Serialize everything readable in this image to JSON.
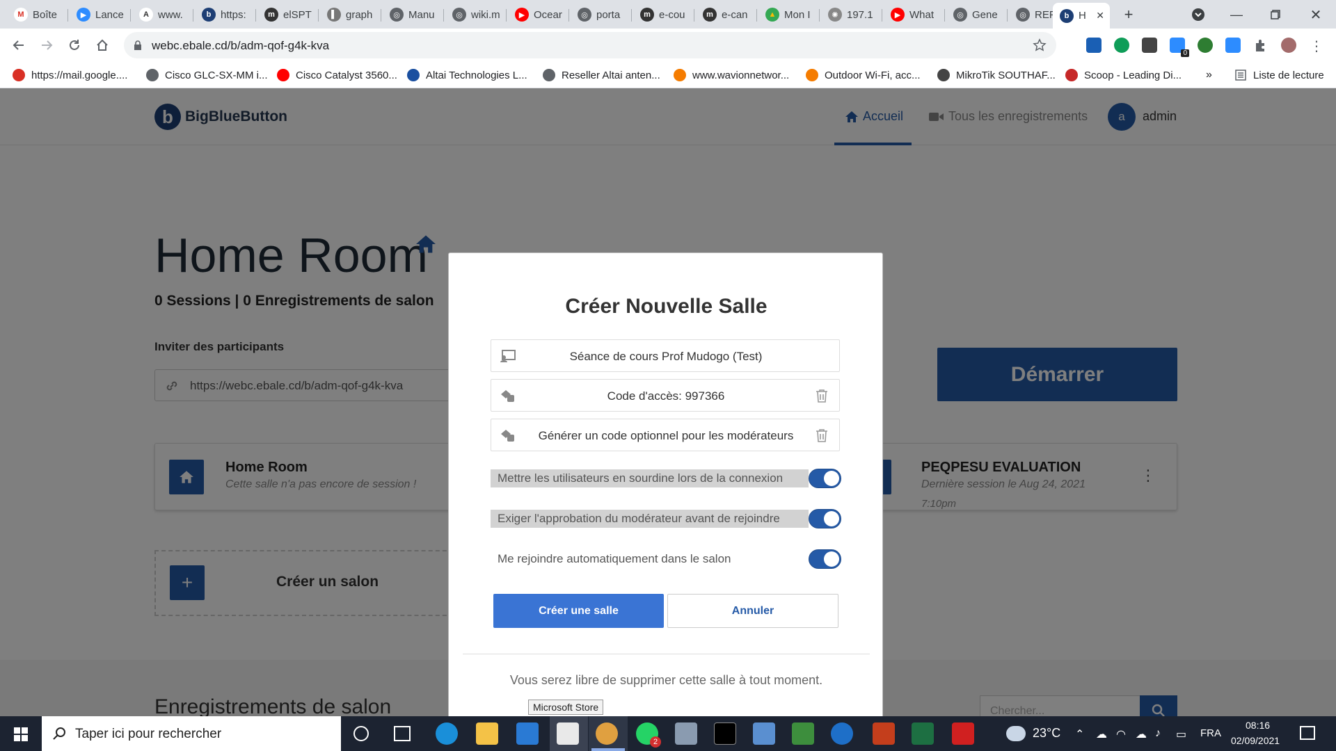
{
  "browser": {
    "tabs": [
      {
        "label": "Boîte",
        "color": "#ffffff",
        "glyph": "M",
        "glyph_color": "#d93025"
      },
      {
        "label": "Lance",
        "color": "#2d8cff",
        "glyph": "▶",
        "glyph_color": "#ffffff"
      },
      {
        "label": "www.",
        "color": "#ffffff",
        "glyph": "A",
        "glyph_color": "#333333"
      },
      {
        "label": "https:",
        "color": "#1d3e74",
        "glyph": "b",
        "glyph_color": "#ffffff"
      },
      {
        "label": "elSPT",
        "color": "#333333",
        "glyph": "m",
        "glyph_color": "#ffffff"
      },
      {
        "label": "graph",
        "color": "#777777",
        "glyph": "▌",
        "glyph_color": "#ffffff"
      },
      {
        "label": "Manu",
        "color": "#5f6368",
        "glyph": "◎",
        "glyph_color": "#ffffff"
      },
      {
        "label": "wiki.m",
        "color": "#5f6368",
        "glyph": "◎",
        "glyph_color": "#ffffff"
      },
      {
        "label": "Ocear",
        "color": "#ff0000",
        "glyph": "▶",
        "glyph_color": "#ffffff"
      },
      {
        "label": "porta",
        "color": "#5f6368",
        "glyph": "◎",
        "glyph_color": "#ffffff"
      },
      {
        "label": "e-cou",
        "color": "#333333",
        "glyph": "m",
        "glyph_color": "#ffffff"
      },
      {
        "label": "e-can",
        "color": "#333333",
        "glyph": "m",
        "glyph_color": "#ffffff"
      },
      {
        "label": "Mon I",
        "color": "#34a853",
        "glyph": "▲",
        "glyph_color": "#fbbc04"
      },
      {
        "label": "197.1",
        "color": "#888888",
        "glyph": "✺",
        "glyph_color": "#ffffff"
      },
      {
        "label": "What",
        "color": "#ff0000",
        "glyph": "▶",
        "glyph_color": "#ffffff"
      },
      {
        "label": "Gene",
        "color": "#5f6368",
        "glyph": "◎",
        "glyph_color": "#ffffff"
      },
      {
        "label": "REFEI",
        "color": "#5f6368",
        "glyph": "◎",
        "glyph_color": "#ffffff"
      },
      {
        "label": "H",
        "color": "#1d3e74",
        "glyph": "b",
        "glyph_color": "#ffffff"
      }
    ],
    "url": "webc.ebale.cd/b/adm-qof-g4k-kva",
    "bookmarks": [
      {
        "label": "https://mail.google....",
        "color": "#d93025"
      },
      {
        "label": "Cisco GLC-SX-MM i...",
        "color": "#5f6368"
      },
      {
        "label": "Cisco Catalyst 3560...",
        "color": "#ff0000"
      },
      {
        "label": "Altai Technologies L...",
        "color": "#1a4fa0"
      },
      {
        "label": "Reseller Altai anten...",
        "color": "#5f6368"
      },
      {
        "label": "www.wavionnetwor...",
        "color": "#f57c00"
      },
      {
        "label": "Outdoor Wi-Fi, acc...",
        "color": "#f57c00"
      },
      {
        "label": "MikroTik SOUTHAF...",
        "color": "#444444"
      },
      {
        "label": "Scoop - Leading Di...",
        "color": "#c62828"
      }
    ],
    "bookmarks_more": "»",
    "reading_list": "Liste de lecture",
    "extension_badge": "0"
  },
  "app": {
    "brand": "BigBlueButton",
    "nav_home": "Accueil",
    "nav_recordings": "Tous les enregistrements",
    "avatar_initial": "a",
    "user_name": "admin",
    "room_title": "Home Room",
    "room_stats": "0 Sessions | 0 Enregistrements de salon",
    "invite_label": "Inviter des participants",
    "invite_url": "https://webc.ebale.cd/b/adm-qof-g4k-kva",
    "start_button": "Démarrer",
    "card1_title": "Home Room",
    "card1_sub": "Cette salle n'a pas encore de session !",
    "card2_title": "PEQPESU EVALUATION",
    "card2_sub_line1": "Dernière session le Aug 24, 2021",
    "card2_sub_line2": "7:10pm",
    "create_room_label": "Créer un salon",
    "recordings_title": "Enregistrements de salon",
    "search_placeholder": "Chercher..."
  },
  "modal": {
    "title": "Créer Nouvelle Salle",
    "room_name": "Séance de cours Prof Mudogo (Test)",
    "access_code": "Code d'accès: 997366",
    "moderator_code": "Générer un code optionnel pour les modérateurs",
    "toggle_mute": "Mettre les utilisateurs en sourdine lors de la connexion",
    "toggle_approval": "Exiger l'approbation du modérateur avant de rejoindre",
    "toggle_autojoin": "Me rejoindre automatiquement dans le salon",
    "create_button": "Créer une salle",
    "cancel_button": "Annuler",
    "note": "Vous serez libre de supprimer cette salle à tout moment."
  },
  "taskbar": {
    "search_placeholder": "Taper ici pour rechercher",
    "tooltip": "Microsoft Store",
    "whatsapp_badge": "2",
    "temperature": "23°C",
    "language": "FRA",
    "time": "08:16",
    "date": "02/09/2021"
  },
  "colors": {
    "accent": "#255aa7",
    "create_button": "#3a74d4"
  }
}
